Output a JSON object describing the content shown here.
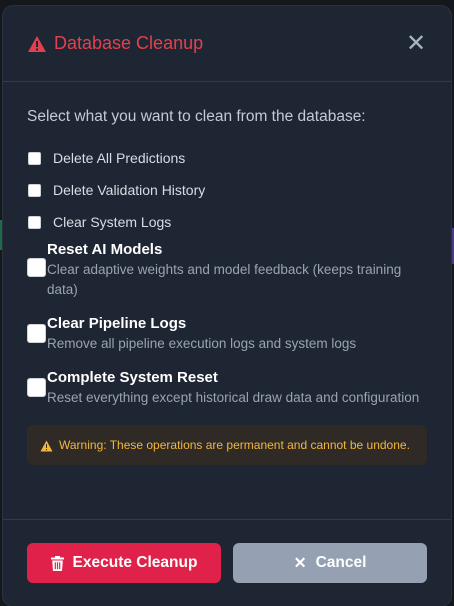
{
  "modal": {
    "title": "Database Cleanup",
    "close_symbol": "✕",
    "intro": "Select what you want to clean from the database:",
    "simple_options": [
      {
        "label": "Delete All Predictions"
      },
      {
        "label": "Delete Validation History"
      },
      {
        "label": "Clear System Logs"
      }
    ],
    "detailed_options": [
      {
        "title": "Reset AI Models",
        "description": "Clear adaptive weights and model feedback (keeps training data)"
      },
      {
        "title": "Clear Pipeline Logs",
        "description": "Remove all pipeline execution logs and system logs"
      },
      {
        "title": "Complete System Reset",
        "description": "Reset everything except historical draw data and configuration"
      }
    ],
    "warning": "Warning: These operations are permanent and cannot be undone.",
    "buttons": {
      "execute": "Execute Cleanup",
      "cancel": "Cancel",
      "cancel_symbol": "✕"
    }
  },
  "colors": {
    "accent_red": "#e2404e",
    "execute_bg": "#e0224a",
    "cancel_bg": "#95a1b2",
    "warning_text": "#f2b63c"
  },
  "icons": [
    "warning-triangle-icon",
    "close-icon",
    "trash-icon"
  ]
}
